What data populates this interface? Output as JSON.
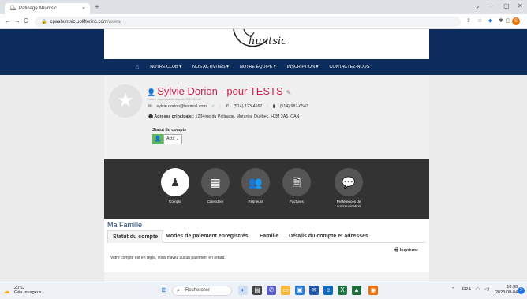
{
  "browser": {
    "tab_title": "Patinage Ahuntsic",
    "tab_close": "×",
    "new_tab": "+",
    "url_host": "cpaahuntsic.uplifterinc.com",
    "url_path": "/users/",
    "profile_initial": "S"
  },
  "site": {
    "logo_text": "huntsic",
    "nav": [
      {
        "label": "NOTRE CLUB ▾"
      },
      {
        "label": "NOS ACTIVITÉS ▾"
      },
      {
        "label": "NOTRE ÉQUIPE ▾"
      },
      {
        "label": "INSCRIPTION ▾"
      },
      {
        "label": "CONTACTEZ-NOUS"
      }
    ]
  },
  "profile": {
    "name": "Sylvie Dorion - pour TESTS",
    "subtitle": "Parent responsable depuis 2017-07-11",
    "email": "sylvie.dorion@hotmail.com",
    "phone": "(514) 123-4567",
    "mobile": "(514) 987-6543",
    "address_label": "Adresse principale :",
    "address": "1234rue du Patinage, Montréal Québec, H2M 2A6, CAN",
    "status_label": "Statut du compte",
    "status_value": "Actif"
  },
  "menu": [
    {
      "label": "Compte",
      "active": true,
      "icon": "user-icon"
    },
    {
      "label": "Calendrier",
      "active": false,
      "icon": "calendar-icon"
    },
    {
      "label": "Patineurs",
      "active": false,
      "icon": "users-icon"
    },
    {
      "label": "Factures",
      "active": false,
      "icon": "invoice-icon"
    },
    {
      "label": "Préférences de communication",
      "active": false,
      "icon": "chat-icon"
    }
  ],
  "family": {
    "title": "Ma Famille",
    "tabs": [
      {
        "label": "Statut du compte",
        "active": true
      },
      {
        "label": "Modes de paiement enregistrés",
        "active": false
      },
      {
        "label": "Famille",
        "active": false
      },
      {
        "label": "Détails du compte et adresses",
        "active": false
      }
    ],
    "print_label": "Imprimer",
    "message": "Votre compte est en règle, vous n'avez aucun paiement en retard."
  },
  "taskbar": {
    "temp": "20°C",
    "weather": "Gén. nuageux",
    "search": "Rechercher",
    "lang": "FRA",
    "time": "10:30",
    "date": "2023-08-04",
    "notifications": "2"
  }
}
